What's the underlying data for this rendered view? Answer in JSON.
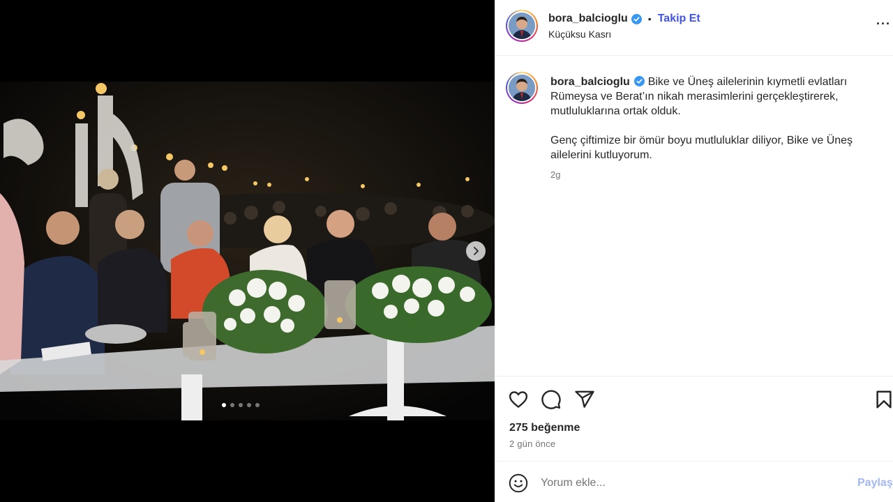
{
  "post": {
    "username": "bora_balcioglu",
    "separator": "•",
    "follow_label": "Takip Et",
    "location": "Küçüksu Kasrı",
    "more_label": "···"
  },
  "caption": {
    "username": "bora_balcioglu",
    "paragraph1": "Bike ve Üneş ailelerinin kıymetli evlatları Rümeysa ve Berat’ın nikah merasimlerini gerçekleştirerek, mutluluklarına ortak olduk.",
    "paragraph2": "Genç çiftimize bir ömür boyu mutluluklar diliyor, Bike ve Üneş ailelerini kutluyorum.",
    "age": "2g"
  },
  "stats": {
    "likes": "275 beğenme",
    "date": "2 gün önce"
  },
  "comment": {
    "placeholder": "Yorum ekle...",
    "share_label": "Paylaş"
  },
  "carousel": {
    "total": 5,
    "current": 1
  },
  "colors": {
    "follow": "#4154e5",
    "verified": "#3897f0",
    "share_disabled": "#a3b7f5",
    "muted": "#737373"
  },
  "icons": [
    "verified-icon",
    "more-icon",
    "heart-icon",
    "comment-icon",
    "share-icon",
    "bookmark-icon",
    "emoji-icon",
    "chevron-right-icon"
  ]
}
